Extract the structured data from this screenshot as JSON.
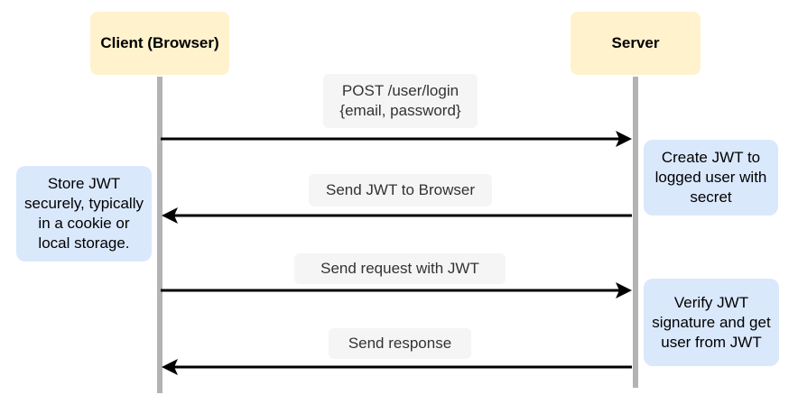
{
  "actors": {
    "client": "Client (Browser)",
    "server": "Server"
  },
  "messages": {
    "login": {
      "line1": "POST /user/login",
      "line2": "{email, password}"
    },
    "send_jwt": "Send JWT to Browser",
    "send_request": "Send request with JWT",
    "send_response": "Send response"
  },
  "notes": {
    "create_jwt": "Create JWT to\nlogged user with\nsecret",
    "store_jwt": "Store JWT\nsecurely, typically\nin a cookie or\nlocal storage.",
    "verify_jwt": "Verify JWT\nsignature and get\nuser from JWT"
  },
  "colors": {
    "actor_fill": "#fff2cc",
    "note_fill": "#dae8fc",
    "label_fill": "#f5f5f5",
    "lifeline": "#b3b3b3",
    "arrow": "#000000"
  }
}
